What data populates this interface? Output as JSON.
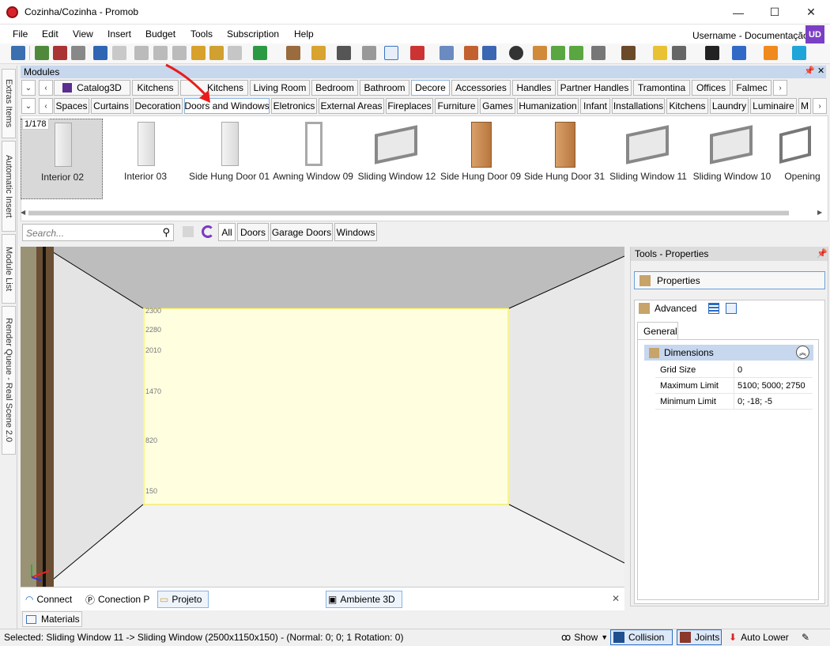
{
  "window": {
    "title": "Cozinha/Cozinha - Promob",
    "min": "—",
    "max": "☐",
    "close": "✕"
  },
  "menu": [
    "File",
    "Edit",
    "View",
    "Insert",
    "Budget",
    "Tools",
    "Subscription",
    "Help"
  ],
  "user": {
    "name": "Username - Documentação",
    "initials": "UD"
  },
  "sidebar": {
    "tabs": [
      "Extras Items",
      "Automatic Insert",
      "Module List",
      "Render Queue - Real Scene 2.0"
    ]
  },
  "modules": {
    "title": "Modules",
    "top_tabs": [
      "Catalog3D",
      "Kitchens",
      "Kitchens",
      "Living Room",
      "Bedroom",
      "Bathroom",
      "Decore",
      "Accessories",
      "Handles",
      "Partner Handles",
      "Tramontina",
      "Offices",
      "Falmec"
    ],
    "top_active": "Decore",
    "sub_tabs": [
      "Spaces",
      "Curtains",
      "Decoration",
      "Doors and Windows",
      "Eletronics",
      "External Areas",
      "Fireplaces",
      "Furniture",
      "Games",
      "Humanization",
      "Infant",
      "Installations",
      "Kitchens",
      "Laundry",
      "Luminaire",
      "M"
    ],
    "sub_active": "Doors and Windows",
    "counter": "1/178",
    "items": [
      {
        "label": "Interior 02",
        "kind": "door"
      },
      {
        "label": "Interior 03",
        "kind": "door"
      },
      {
        "label": "Side Hung Door 01",
        "kind": "door"
      },
      {
        "label": "Awning Window 09",
        "kind": "tall"
      },
      {
        "label": "Sliding Window 12",
        "kind": "window"
      },
      {
        "label": "Side Hung Door 09",
        "kind": "wood"
      },
      {
        "label": "Side Hung Door 31",
        "kind": "wood"
      },
      {
        "label": "Sliding Window 11",
        "kind": "window"
      },
      {
        "label": "Sliding Window 10",
        "kind": "window"
      },
      {
        "label": "Opening",
        "kind": "frame"
      }
    ]
  },
  "filter": {
    "placeholder": "Search...",
    "tabs": [
      "All",
      "Doors",
      "Garage Doors",
      "Windows"
    ],
    "active": "All"
  },
  "viewport": {
    "ruler": [
      "2300",
      "2280",
      "2010",
      "1470",
      "820",
      "150"
    ],
    "tabs": [
      {
        "label": "Connect",
        "icon": "connect-icon"
      },
      {
        "label": "Conection P",
        "icon": "conection-icon"
      },
      {
        "label": "Projeto",
        "icon": "folder-icon"
      },
      {
        "label": "Ambiente 3D",
        "icon": "view3d-icon"
      }
    ],
    "close": "✕"
  },
  "properties": {
    "panel_title": "Tools - Properties",
    "button": "Properties",
    "advanced": "Advanced",
    "tab": "General",
    "section": "Dimensions",
    "rows": [
      {
        "name": "Grid Size",
        "value": "0"
      },
      {
        "name": "Maximum Limit",
        "value": "5100; 5000; 2750"
      },
      {
        "name": "Minimum Limit",
        "value": "0; -18; -5"
      }
    ]
  },
  "bottom": {
    "materials": "Materials"
  },
  "status": {
    "text": "Selected: Sliding Window 11 -> Sliding Window (2500x1150x150) - (Normal: 0; 0; 1 Rotation: 0)",
    "show": "Show",
    "collision": "Collision",
    "joints": "Joints",
    "auto_lower": "Auto Lower"
  },
  "colors": {
    "accent": "#c6d7ee",
    "highlight": "#ffffe0",
    "arrow": "#e81c1c",
    "avatar": "#7b3fc5"
  }
}
